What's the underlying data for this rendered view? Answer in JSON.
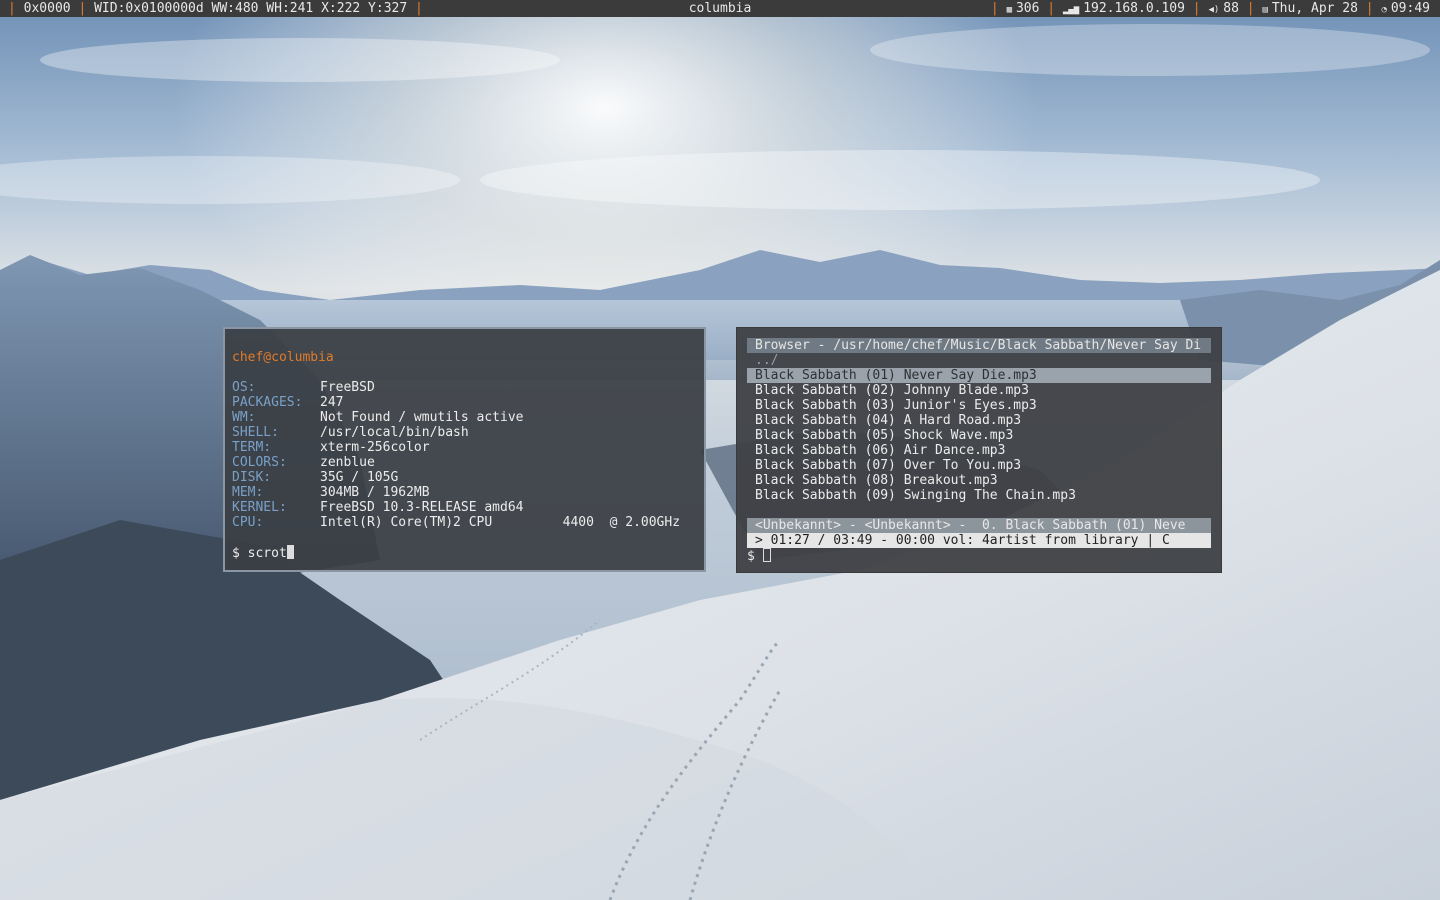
{
  "topbar": {
    "left": {
      "desktop": "0x0000",
      "window_info": "WID:0x0100000d WW:480 WH:241 X:222 Y:327"
    },
    "center_title": "columbia",
    "right": {
      "memory_icon": "memory-icon",
      "memory": "306",
      "network_icon": "signal-icon",
      "ip": "192.168.0.109",
      "volume_icon": "speaker-icon",
      "volume": "88",
      "calendar_icon": "calendar-icon",
      "date": "Thu, Apr 28",
      "clock_icon": "clock-icon",
      "time": "09:49"
    },
    "separator": "|",
    "accent": "#e07b2a"
  },
  "fetch_terminal": {
    "user_host": "chef@columbia",
    "rows": [
      {
        "key": "OS:",
        "value": "FreeBSD"
      },
      {
        "key": "PACKAGES:",
        "value": "247"
      },
      {
        "key": "WM:",
        "value": "Not Found / wmutils active"
      },
      {
        "key": "SHELL:",
        "value": "/usr/local/bin/bash"
      },
      {
        "key": "TERM:",
        "value": "xterm-256color"
      },
      {
        "key": "COLORS:",
        "value": "zenblue"
      },
      {
        "key": "DISK:",
        "value": "35G / 105G"
      },
      {
        "key": "MEM:",
        "value": "304MB / 1962MB"
      },
      {
        "key": "KERNEL:",
        "value": "FreeBSD 10.3-RELEASE amd64"
      },
      {
        "key": "CPU:",
        "value": "Intel(R) Core(TM)2 CPU         4400  @ 2.00GHz"
      }
    ],
    "prompt": "$ scrot"
  },
  "music_terminal": {
    "header": "Browser - /usr/home/chef/Music/Black Sabbath/Never Say Di",
    "parent_dir": "../",
    "tracks": [
      "Black Sabbath (01) Never Say Die.mp3",
      "Black Sabbath (02) Johnny Blade.mp3",
      "Black Sabbath (03) Junior's Eyes.mp3",
      "Black Sabbath (04) A Hard Road.mp3",
      "Black Sabbath (05) Shock Wave.mp3",
      "Black Sabbath (06) Air Dance.mp3",
      "Black Sabbath (07) Over To You.mp3",
      "Black Sabbath (08) Breakout.mp3",
      "Black Sabbath (09) Swinging The Chain.mp3"
    ],
    "status": "<Unbekannt> - <Unbekannt> -  0. Black Sabbath (01) Neve",
    "player": "> 01:27 / 03:49 - 00:00 vol: 4artist from library | C",
    "prompt": "$ "
  }
}
